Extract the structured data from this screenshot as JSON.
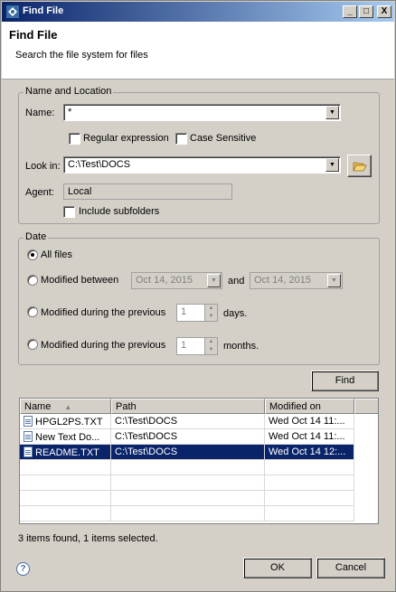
{
  "window": {
    "title": "Find File",
    "controls": {
      "minimize": "_",
      "maximize": "□",
      "close": "X"
    }
  },
  "header": {
    "title": "Find File",
    "description": "Search the file system for files"
  },
  "name_location": {
    "group_label": "Name and Location",
    "name_label": "Name:",
    "name_value": "*",
    "regex_label": "Regular expression",
    "regex_checked": false,
    "case_label": "Case Sensitive",
    "case_checked": false,
    "lookin_label": "Look in:",
    "lookin_value": "C:\\Test\\DOCS",
    "agent_label": "Agent:",
    "agent_value": "Local",
    "subfolders_label": "Include subfolders",
    "subfolders_checked": false
  },
  "date": {
    "group_label": "Date",
    "all_files_label": "All files",
    "modified_between_label": "Modified between",
    "from_date": "Oct 14, 2015",
    "and_label": "and",
    "to_date": "Oct 14, 2015",
    "prev_days_label": "Modified during the previous",
    "prev_days_value": "1",
    "days_label": "days.",
    "prev_months_label": "Modified during the previous",
    "prev_months_value": "1",
    "months_label": "months.",
    "selected_option": "All files"
  },
  "find_button": "Find",
  "results": {
    "columns": [
      "Name",
      "Path",
      "Modified on"
    ],
    "rows": [
      {
        "name": "HPGL2PS.TXT",
        "path": "C:\\Test\\DOCS",
        "modified": "Wed Oct 14 11:...",
        "selected": false
      },
      {
        "name": "New Text Do...",
        "path": "C:\\Test\\DOCS",
        "modified": "Wed Oct 14 11:...",
        "selected": false
      },
      {
        "name": "README.TXT",
        "path": "C:\\Test\\DOCS",
        "modified": "Wed Oct 14 12:...",
        "selected": true
      }
    ]
  },
  "status": "3 items found, 1 items selected.",
  "footer": {
    "help_glyph": "?",
    "ok_label": "OK",
    "cancel_label": "Cancel"
  },
  "colors": {
    "title_bar": "#0a246a",
    "selection": "#0a246a",
    "dialog_bg": "#d4d0c8"
  },
  "icons": [
    "app-icon",
    "folder-open-icon",
    "help-icon",
    "file-icon",
    "sort-ascending-icon"
  ]
}
